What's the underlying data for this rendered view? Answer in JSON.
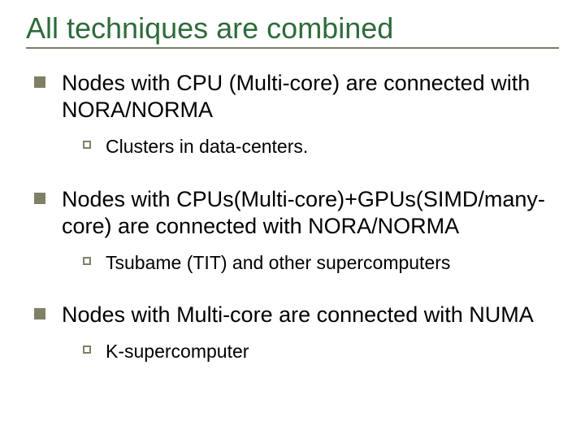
{
  "title": "All techniques are combined",
  "items": [
    {
      "text": "Nodes with CPU (Multi-core) are connected with NORA/NORMA",
      "sub": [
        {
          "text": "Clusters in data-centers."
        }
      ]
    },
    {
      "text": "Nodes with CPUs(Multi-core)+GPUs(SIMD/many-core) are connected with NORA/NORMA",
      "sub": [
        {
          "text": " Tsubame (TIT) and other supercomputers"
        }
      ]
    },
    {
      "text": "Nodes with Multi-core are connected with NUMA",
      "sub": [
        {
          "text": "K-supercomputer"
        }
      ]
    }
  ]
}
